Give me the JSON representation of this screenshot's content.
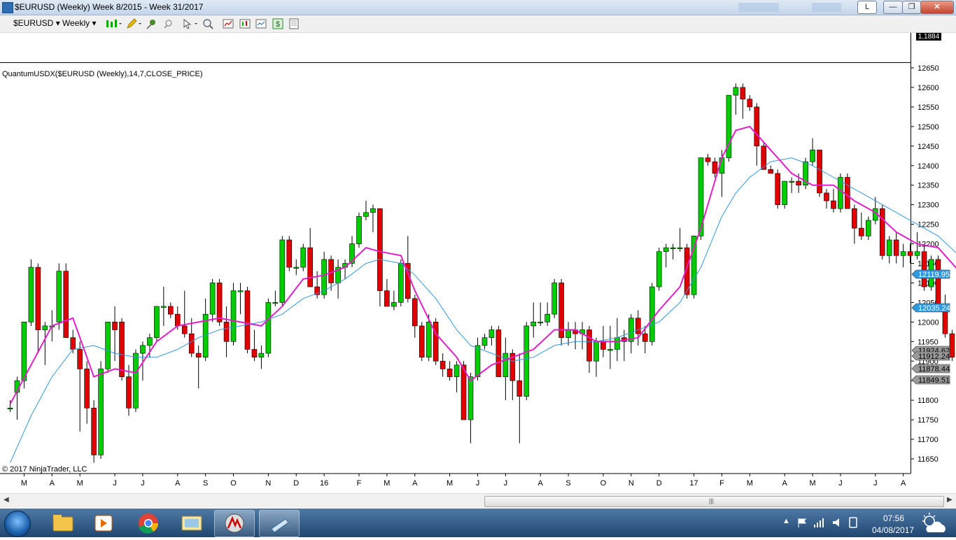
{
  "window": {
    "title": "$EURUSD (Weekly)  Week 8/2015 - Week 31/2017",
    "badge": "L",
    "minimize_label": "—",
    "maximize_label": "❐",
    "close_label": "✕"
  },
  "toolbar": {
    "instrument": "$EURUSD",
    "period": "Weekly",
    "dropdown_glyph": "▾"
  },
  "chart": {
    "indicator_label": "QuantumUSDX($EURUSD (Weekly),14,7,CLOSE_PRICE)",
    "copyright": "© 2017 NinjaTrader, LLC",
    "upper_panel_value": "1.1884",
    "colors": {
      "up": "#00cc00",
      "down": "#e00000",
      "fast_ma": "#e020c8",
      "slow_ma": "#3399dd",
      "badge_blue": "#3399dd",
      "badge_gray": "#999999"
    }
  },
  "chart_data": {
    "type": "candlestick",
    "y_ticks": [
      11650,
      11700,
      11750,
      11800,
      11850,
      11900,
      11950,
      12000,
      12050,
      12100,
      12150,
      12200,
      12250,
      12300,
      12350,
      12400,
      12450,
      12500,
      12550,
      12600,
      12650
    ],
    "ylim": [
      11630,
      12665
    ],
    "x_labels": [
      {
        "label": "M",
        "week": 2
      },
      {
        "label": "A",
        "week": 6
      },
      {
        "label": "M",
        "week": 10
      },
      {
        "label": "J",
        "week": 15
      },
      {
        "label": "J",
        "week": 19
      },
      {
        "label": "A",
        "week": 24
      },
      {
        "label": "S",
        "week": 28
      },
      {
        "label": "O",
        "week": 32
      },
      {
        "label": "N",
        "week": 37
      },
      {
        "label": "D",
        "week": 41
      },
      {
        "label": "16",
        "week": 45
      },
      {
        "label": "F",
        "week": 50
      },
      {
        "label": "M",
        "week": 54
      },
      {
        "label": "A",
        "week": 58
      },
      {
        "label": "M",
        "week": 63
      },
      {
        "label": "J",
        "week": 67
      },
      {
        "label": "J",
        "week": 71
      },
      {
        "label": "A",
        "week": 76
      },
      {
        "label": "S",
        "week": 80
      },
      {
        "label": "O",
        "week": 85
      },
      {
        "label": "N",
        "week": 89
      },
      {
        "label": "D",
        "week": 93
      },
      {
        "label": "17",
        "week": 98
      },
      {
        "label": "F",
        "week": 102
      },
      {
        "label": "M",
        "week": 106
      },
      {
        "label": "A",
        "week": 111
      },
      {
        "label": "M",
        "week": 115
      },
      {
        "label": "J",
        "week": 119
      },
      {
        "label": "J",
        "week": 124
      },
      {
        "label": "A",
        "week": 128
      }
    ],
    "price_badges": [
      {
        "value": "12119.95",
        "style": "blue"
      },
      {
        "value": "12035.24",
        "style": "blue"
      },
      {
        "value": "11924.62",
        "style": "gray"
      },
      {
        "value": "11912.24",
        "style": "gray"
      },
      {
        "value": "11878.44",
        "style": "gray"
      },
      {
        "value": "11849.51",
        "style": "gray"
      }
    ],
    "candles": [
      [
        11780,
        11800,
        11770,
        11780
      ],
      [
        11820,
        11860,
        11750,
        11850
      ],
      [
        11850,
        12000,
        11830,
        12000
      ],
      [
        12000,
        12160,
        11990,
        12140
      ],
      [
        12140,
        12150,
        11920,
        11980
      ],
      [
        11980,
        12000,
        11890,
        11990
      ],
      [
        11990,
        12030,
        11950,
        11990
      ],
      [
        12000,
        12150,
        11980,
        12130
      ],
      [
        12130,
        12150,
        11960,
        11960
      ],
      [
        11960,
        11980,
        11920,
        11930
      ],
      [
        11930,
        11950,
        11720,
        11880
      ],
      [
        11880,
        11900,
        11740,
        11780
      ],
      [
        11780,
        11800,
        11640,
        11660
      ],
      [
        11660,
        11900,
        11650,
        11880
      ],
      [
        11880,
        12000,
        11870,
        12000
      ],
      [
        12000,
        12040,
        11900,
        11980
      ],
      [
        12000,
        12010,
        11850,
        11860
      ],
      [
        11860,
        11890,
        11760,
        11780
      ],
      [
        11780,
        11930,
        11770,
        11920
      ],
      [
        11920,
        11950,
        11850,
        11940
      ],
      [
        11940,
        11970,
        11910,
        11960
      ],
      [
        11960,
        12040,
        11950,
        12040
      ],
      [
        12040,
        12090,
        11990,
        12040
      ],
      [
        12040,
        12050,
        12010,
        12020
      ],
      [
        12020,
        12040,
        11980,
        11990
      ],
      [
        11990,
        12080,
        11960,
        11970
      ],
      [
        11970,
        12010,
        11910,
        11920
      ],
      [
        11920,
        11940,
        11830,
        11910
      ],
      [
        11910,
        12060,
        11900,
        12020
      ],
      [
        12020,
        12110,
        12000,
        12100
      ],
      [
        12100,
        12110,
        11990,
        12000
      ],
      [
        12000,
        12040,
        11910,
        11950
      ],
      [
        11950,
        12100,
        11940,
        12080
      ],
      [
        12080,
        12100,
        12020,
        12080
      ],
      [
        12080,
        12090,
        11920,
        11930
      ],
      [
        11930,
        11980,
        11900,
        11910
      ],
      [
        11910,
        11940,
        11880,
        11920
      ],
      [
        11920,
        12060,
        11910,
        12050
      ],
      [
        12050,
        12080,
        12040,
        12050
      ],
      [
        12050,
        12220,
        12040,
        12210
      ],
      [
        12210,
        12220,
        12130,
        12140
      ],
      [
        12140,
        12160,
        12120,
        12140
      ],
      [
        12140,
        12200,
        12130,
        12190
      ],
      [
        12190,
        12240,
        12120,
        12090
      ],
      [
        12090,
        12130,
        12060,
        12070
      ],
      [
        12070,
        12180,
        12060,
        12160
      ],
      [
        12160,
        12170,
        12080,
        12100
      ],
      [
        12100,
        12160,
        12060,
        12140
      ],
      [
        12140,
        12160,
        12110,
        12150
      ],
      [
        12150,
        12220,
        12140,
        12200
      ],
      [
        12200,
        12280,
        12190,
        12270
      ],
      [
        12270,
        12310,
        12260,
        12280
      ],
      [
        12280,
        12300,
        12230,
        12290
      ],
      [
        12290,
        12290,
        12040,
        12080
      ],
      [
        12080,
        12110,
        12040,
        12040
      ],
      [
        12040,
        12080,
        12030,
        12050
      ],
      [
        12050,
        12160,
        12040,
        12150
      ],
      [
        12150,
        12220,
        12050,
        12060
      ],
      [
        12060,
        12070,
        11960,
        11990
      ],
      [
        11990,
        12000,
        11900,
        11910
      ],
      [
        11910,
        12020,
        11900,
        12000
      ],
      [
        12000,
        12010,
        11890,
        11900
      ],
      [
        11900,
        11920,
        11860,
        11880
      ],
      [
        11880,
        11900,
        11850,
        11860
      ],
      [
        11860,
        11900,
        11820,
        11890
      ],
      [
        11890,
        11900,
        11750,
        11750
      ],
      [
        11750,
        11870,
        11690,
        11860
      ],
      [
        11860,
        11960,
        11850,
        11940
      ],
      [
        11940,
        11970,
        11930,
        11960
      ],
      [
        11960,
        11990,
        11940,
        11980
      ],
      [
        11980,
        11990,
        11860,
        11860
      ],
      [
        11860,
        11960,
        11800,
        11920
      ],
      [
        11920,
        11930,
        11800,
        11850
      ],
      [
        11850,
        11920,
        11690,
        11810
      ],
      [
        11810,
        12000,
        11800,
        11990
      ],
      [
        11990,
        12050,
        11960,
        12000
      ],
      [
        12000,
        12050,
        11990,
        12000
      ],
      [
        12000,
        12050,
        11990,
        12020
      ],
      [
        12020,
        12110,
        12010,
        12100
      ],
      [
        12100,
        12110,
        11940,
        11960
      ],
      [
        11960,
        12000,
        11940,
        11980
      ],
      [
        11980,
        12000,
        11930,
        11970
      ],
      [
        11970,
        12000,
        11930,
        11980
      ],
      [
        11980,
        11990,
        11870,
        11900
      ],
      [
        11900,
        11960,
        11860,
        11950
      ],
      [
        11950,
        11990,
        11910,
        11930
      ],
      [
        11930,
        11990,
        11880,
        11930
      ],
      [
        11930,
        12010,
        11900,
        11960
      ],
      [
        11960,
        11980,
        11900,
        11950
      ],
      [
        11950,
        12020,
        11920,
        12010
      ],
      [
        12010,
        12030,
        11940,
        11970
      ],
      [
        11970,
        11990,
        11920,
        11950
      ],
      [
        11950,
        12100,
        11940,
        12090
      ],
      [
        12090,
        12190,
        12080,
        12180
      ],
      [
        12180,
        12200,
        12140,
        12190
      ],
      [
        12190,
        12200,
        12160,
        12190
      ],
      [
        12190,
        12240,
        12180,
        12190
      ],
      [
        12190,
        12200,
        12060,
        12070
      ],
      [
        12070,
        12220,
        12060,
        12220
      ],
      [
        12220,
        12420,
        12210,
        12420
      ],
      [
        12420,
        12430,
        12400,
        12410
      ],
      [
        12410,
        12420,
        12370,
        12380
      ],
      [
        12380,
        12440,
        12320,
        12420
      ],
      [
        12420,
        12580,
        12410,
        12580
      ],
      [
        12580,
        12610,
        12530,
        12600
      ],
      [
        12600,
        12610,
        12520,
        12570
      ],
      [
        12570,
        12580,
        12540,
        12550
      ],
      [
        12550,
        12560,
        12400,
        12450
      ],
      [
        12450,
        12460,
        12390,
        12390
      ],
      [
        12390,
        12400,
        12380,
        12380
      ],
      [
        12380,
        12390,
        12290,
        12300
      ],
      [
        12300,
        12360,
        12290,
        12360
      ],
      [
        12360,
        12370,
        12330,
        12360
      ],
      [
        12360,
        12380,
        12330,
        12350
      ],
      [
        12350,
        12420,
        12340,
        12410
      ],
      [
        12410,
        12470,
        12400,
        12440
      ],
      [
        12440,
        12440,
        12320,
        12330
      ],
      [
        12330,
        12340,
        12290,
        12310
      ],
      [
        12310,
        12340,
        12280,
        12290
      ],
      [
        12290,
        12380,
        12280,
        12370
      ],
      [
        12370,
        12380,
        12290,
        12290
      ],
      [
        12290,
        12300,
        12200,
        12240
      ],
      [
        12240,
        12280,
        12210,
        12220
      ],
      [
        12220,
        12270,
        12210,
        12260
      ],
      [
        12260,
        12320,
        12250,
        12290
      ],
      [
        12290,
        12300,
        12160,
        12170
      ],
      [
        12170,
        12220,
        12150,
        12210
      ],
      [
        12210,
        12230,
        12150,
        12170
      ],
      [
        12170,
        12200,
        12140,
        12180
      ],
      [
        12180,
        12200,
        12150,
        12170
      ],
      [
        12170,
        12230,
        12160,
        12180
      ],
      [
        12180,
        12200,
        12080,
        12090
      ],
      [
        12090,
        12170,
        12080,
        12160
      ],
      [
        12160,
        12170,
        12040,
        12040
      ],
      [
        12040,
        12070,
        11960,
        11970
      ],
      [
        11970,
        11980,
        11900,
        11910
      ],
      [
        11910,
        11920,
        11840,
        11880
      ]
    ],
    "fast_ma": [
      [
        0,
        11790
      ],
      [
        3,
        11890
      ],
      [
        6,
        11990
      ],
      [
        9,
        12010
      ],
      [
        12,
        11860
      ],
      [
        15,
        11880
      ],
      [
        18,
        11870
      ],
      [
        21,
        11950
      ],
      [
        24,
        11990
      ],
      [
        27,
        12000
      ],
      [
        30,
        12010
      ],
      [
        33,
        12000
      ],
      [
        36,
        11990
      ],
      [
        39,
        12040
      ],
      [
        42,
        12110
      ],
      [
        45,
        12120
      ],
      [
        48,
        12140
      ],
      [
        51,
        12190
      ],
      [
        53,
        12180
      ],
      [
        56,
        12170
      ],
      [
        58,
        12080
      ],
      [
        61,
        11970
      ],
      [
        64,
        11910
      ],
      [
        66,
        11850
      ],
      [
        69,
        11890
      ],
      [
        72,
        11910
      ],
      [
        75,
        11930
      ],
      [
        78,
        11980
      ],
      [
        81,
        11980
      ],
      [
        84,
        11950
      ],
      [
        87,
        11950
      ],
      [
        90,
        11960
      ],
      [
        93,
        12030
      ],
      [
        96,
        12090
      ],
      [
        99,
        12240
      ],
      [
        102,
        12420
      ],
      [
        104,
        12490
      ],
      [
        106,
        12500
      ],
      [
        109,
        12440
      ],
      [
        112,
        12380
      ],
      [
        115,
        12350
      ],
      [
        118,
        12350
      ],
      [
        121,
        12310
      ],
      [
        124,
        12280
      ],
      [
        127,
        12230
      ],
      [
        130,
        12200
      ],
      [
        133,
        12190
      ],
      [
        136,
        12130
      ],
      [
        139,
        12030
      ]
    ],
    "slow_ma": [
      [
        0,
        11640
      ],
      [
        3,
        11760
      ],
      [
        6,
        11860
      ],
      [
        9,
        11930
      ],
      [
        12,
        11940
      ],
      [
        15,
        11920
      ],
      [
        18,
        11910
      ],
      [
        21,
        11910
      ],
      [
        24,
        11930
      ],
      [
        27,
        11960
      ],
      [
        30,
        11980
      ],
      [
        33,
        11990
      ],
      [
        36,
        12000
      ],
      [
        39,
        12020
      ],
      [
        42,
        12060
      ],
      [
        45,
        12080
      ],
      [
        48,
        12110
      ],
      [
        51,
        12150
      ],
      [
        53,
        12160
      ],
      [
        56,
        12150
      ],
      [
        58,
        12120
      ],
      [
        61,
        12060
      ],
      [
        64,
        11980
      ],
      [
        66,
        11940
      ],
      [
        69,
        11920
      ],
      [
        72,
        11900
      ],
      [
        75,
        11910
      ],
      [
        78,
        11940
      ],
      [
        81,
        11950
      ],
      [
        84,
        11950
      ],
      [
        87,
        11960
      ],
      [
        90,
        11980
      ],
      [
        93,
        12000
      ],
      [
        96,
        12050
      ],
      [
        99,
        12140
      ],
      [
        102,
        12270
      ],
      [
        104,
        12330
      ],
      [
        106,
        12370
      ],
      [
        109,
        12410
      ],
      [
        112,
        12420
      ],
      [
        115,
        12400
      ],
      [
        118,
        12370
      ],
      [
        121,
        12340
      ],
      [
        124,
        12310
      ],
      [
        127,
        12280
      ],
      [
        130,
        12250
      ],
      [
        133,
        12220
      ],
      [
        136,
        12170
      ],
      [
        139,
        12120
      ]
    ]
  }
}
